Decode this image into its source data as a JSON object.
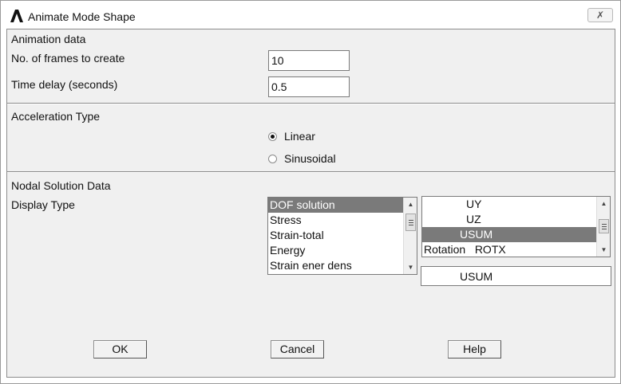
{
  "window": {
    "title": "Animate Mode Shape",
    "close_glyph": "✗"
  },
  "animation": {
    "section_label": "Animation data",
    "frames_label": "No. of frames to create",
    "frames_value": "10",
    "delay_label": "Time delay (seconds)",
    "delay_value": "0.5"
  },
  "acceleration": {
    "section_label": "Acceleration Type",
    "options": [
      {
        "label": "Linear",
        "checked": true
      },
      {
        "label": "Sinusoidal",
        "checked": false
      }
    ]
  },
  "nodal": {
    "section_label": "Nodal Solution Data",
    "display_type_label": "Display Type",
    "display_list": [
      "DOF solution",
      "Stress",
      "Strain-total",
      "Energy",
      "Strain ener dens"
    ],
    "display_selected_index": 0,
    "component_list": [
      "UY",
      "UZ",
      "USUM",
      "Rotation   ROTX"
    ],
    "component_selected_index": 2,
    "component_value": "USUM"
  },
  "buttons": {
    "ok": "OK",
    "cancel": "Cancel",
    "help": "Help"
  },
  "icons": {
    "app": "ansys-logo-icon",
    "close": "close-icon"
  }
}
